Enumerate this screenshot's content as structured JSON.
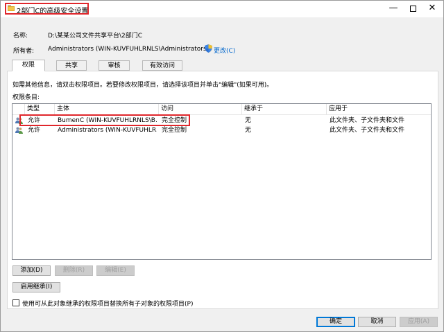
{
  "window": {
    "title": "2部门C的高级安全设置"
  },
  "info": {
    "name_label": "名称:",
    "name_value": "D:\\某某公司文件共享平台\\2部门C",
    "owner_label": "所有者:",
    "owner_value": "Administrators (WIN-KUVFUHLRNLS\\Administrators)",
    "change_link": "更改(C)"
  },
  "tabs": [
    {
      "label": "权限",
      "active": true
    },
    {
      "label": "共享",
      "active": false
    },
    {
      "label": "审核",
      "active": false
    },
    {
      "label": "有效访问",
      "active": false
    }
  ],
  "instructions": "如需其他信息，请双击权限项目。若要修改权限项目，请选择该项目并单击\"编辑\"(如果可用)。",
  "entries_label": "权限条目:",
  "table": {
    "headers": [
      "类型",
      "主体",
      "访问",
      "继承于",
      "应用于"
    ],
    "rows": [
      {
        "type": "允许",
        "principal": "BumenC (WIN-KUVFUHLRNLS\\B...",
        "access": "完全控制",
        "inherited": "无",
        "applies": "此文件夹、子文件夹和文件"
      },
      {
        "type": "允许",
        "principal": "Administrators (WIN-KUVFUHLR...",
        "access": "完全控制",
        "inherited": "无",
        "applies": "此文件夹、子文件夹和文件"
      }
    ]
  },
  "buttons": {
    "add": "添加(D)",
    "remove": "删除(R)",
    "edit": "编辑(E)",
    "enable_inheritance": "启用继承(I)",
    "ok": "确定",
    "cancel": "取消",
    "apply": "应用(A)"
  },
  "replace_checkbox_label": "使用可从此对象继承的权限项目替换所有子对象的权限项目(P)"
}
